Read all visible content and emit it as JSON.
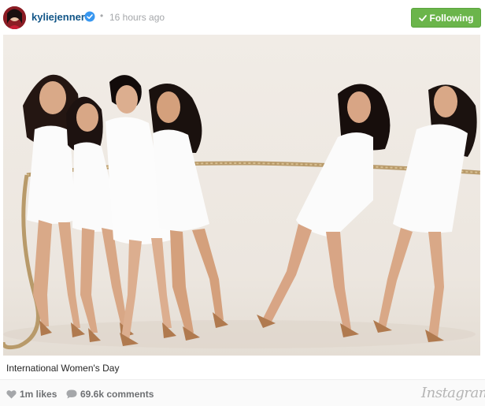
{
  "header": {
    "username": "kyliejenner",
    "separator": "•",
    "time": "16 hours ago",
    "follow_label": "Following",
    "verified_icon": "verified-badge-icon",
    "follow_color": "#6bb54b"
  },
  "post": {
    "caption": "International Women's Day"
  },
  "footer": {
    "likes": "1m likes",
    "comments": "69.6k comments",
    "brand": "Instagram",
    "like_icon": "heart-icon",
    "comment_icon": "speech-bubble-icon"
  }
}
